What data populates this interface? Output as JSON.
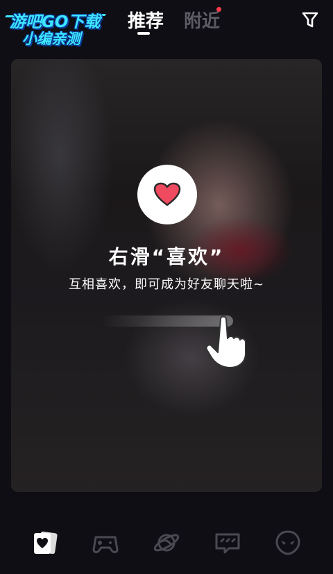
{
  "watermark": {
    "line1": "游吧GO下载",
    "line2": "小编亲测"
  },
  "top_nav": {
    "tabs": [
      {
        "label": "推荐",
        "active": true
      },
      {
        "label": "附近",
        "active": false
      }
    ],
    "near_badge": "red-dot",
    "filter_icon": "funnel-icon"
  },
  "card": {
    "icon": "heart-icon",
    "title": "右滑“喜欢”",
    "subtitle": "互相喜欢，即可成为好友聊天啦~",
    "gesture_icon": "pointing-hand-icon"
  },
  "bottom_nav": {
    "items": [
      {
        "name": "cards",
        "icon": "heart-card-icon",
        "active": true
      },
      {
        "name": "games",
        "icon": "gamepad-icon",
        "active": false
      },
      {
        "name": "planet",
        "icon": "planet-icon",
        "active": false
      },
      {
        "name": "chat",
        "icon": "message-bubble-icon",
        "active": false
      },
      {
        "name": "alien",
        "icon": "alien-face-icon",
        "active": false
      }
    ]
  },
  "colors": {
    "background": "#0f0e14",
    "accent_red": "#ff3b4e",
    "inactive": "#5d5c66",
    "heart": "#f04a60"
  }
}
